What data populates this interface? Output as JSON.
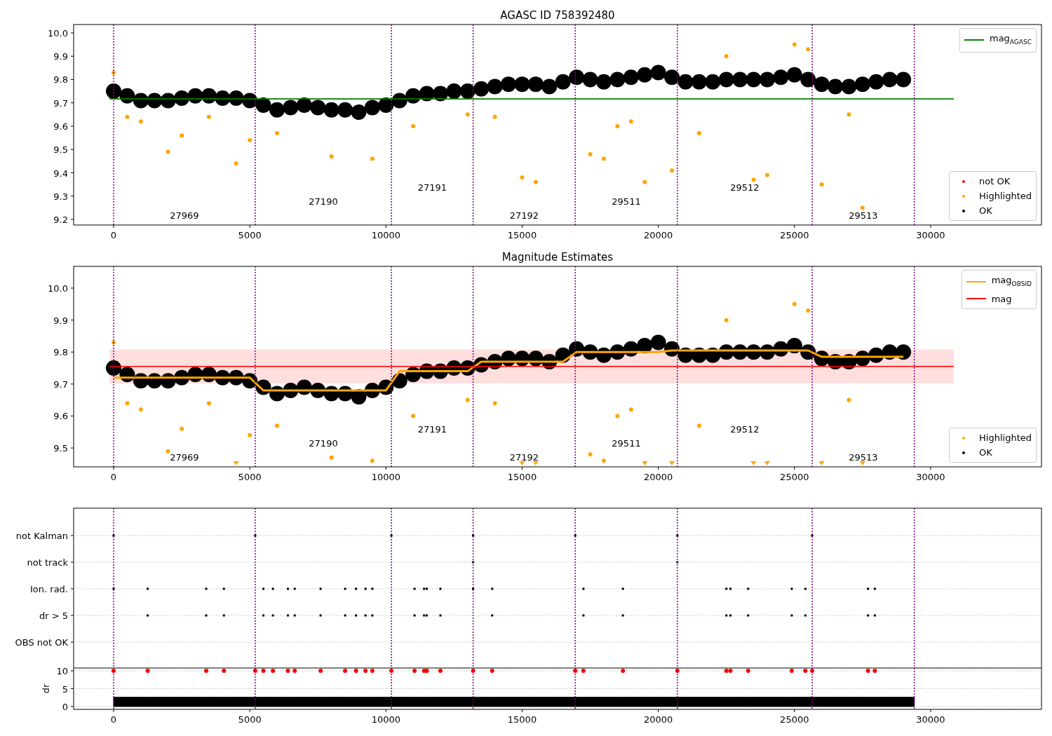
{
  "panels": [
    {
      "title": "AGASC ID 758392480",
      "chart_data": {
        "type": "scatter",
        "legend": "right",
        "xlim": [
          -1468,
          34070
        ],
        "ylim": [
          9.176,
          10.036
        ],
        "xticks": [
          0,
          5000,
          10000,
          15000,
          20000,
          25000,
          30000
        ],
        "yticks": [
          9.2,
          9.3,
          9.4,
          9.5,
          9.6,
          9.7,
          9.8,
          9.9,
          {
            "value": 10,
            "label": "10.0"
          }
        ],
        "x": [
          0,
          500,
          1000,
          1500,
          2000,
          2500,
          3000,
          3500,
          4000,
          4500,
          5000,
          5500,
          6000,
          6500,
          7000,
          7500,
          8000,
          8500,
          9000,
          9500,
          10000,
          10500,
          11000,
          11500,
          12000,
          12500,
          13000,
          13500,
          14000,
          14500,
          15000,
          15500,
          16000,
          16500,
          17000,
          17500,
          18000,
          18500,
          19000,
          19500,
          20000,
          20500,
          21000,
          21500,
          22000,
          22500,
          23000,
          23500,
          24000,
          24500,
          25000,
          25500,
          26000,
          26500,
          27000,
          27500,
          28000,
          28500,
          29000
        ],
        "series": [
          {
            "name": "not OK",
            "color": "#ff0000",
            "values": [
              null,
              null,
              null,
              null,
              null,
              null,
              null,
              null,
              null,
              null,
              null,
              null,
              null,
              null,
              null,
              null,
              null,
              null,
              null,
              null,
              null,
              null,
              null,
              null,
              null,
              null,
              null,
              null,
              null,
              null,
              null,
              null,
              null,
              null,
              null,
              null,
              null,
              null,
              null,
              null,
              null,
              null,
              null,
              null,
              null,
              null,
              null,
              null,
              null,
              null,
              null,
              null,
              null,
              null,
              null,
              null,
              null,
              null,
              null
            ]
          },
          {
            "name": "Highlighted",
            "color": "#ffa500",
            "values": [
              9.83,
              9.64,
              9.62,
              null,
              9.49,
              9.56,
              null,
              9.64,
              null,
              9.44,
              9.54,
              null,
              9.57,
              null,
              null,
              null,
              9.47,
              null,
              null,
              9.46,
              null,
              null,
              9.6,
              null,
              null,
              null,
              9.65,
              null,
              9.64,
              null,
              9.38,
              9.36,
              null,
              null,
              null,
              9.48,
              9.46,
              9.6,
              9.62,
              9.36,
              null,
              9.41,
              null,
              9.57,
              null,
              9.9,
              null,
              9.37,
              9.39,
              null,
              9.95,
              9.93,
              9.35,
              null,
              9.65,
              9.25,
              null,
              null,
              null
            ]
          },
          {
            "name": "OK",
            "color": "#000000",
            "values": [
              9.75,
              9.73,
              9.71,
              9.71,
              9.71,
              9.72,
              9.73,
              9.73,
              9.72,
              9.72,
              9.71,
              9.69,
              9.67,
              9.68,
              9.69,
              9.68,
              9.67,
              9.67,
              9.66,
              9.68,
              9.69,
              9.71,
              9.73,
              9.74,
              9.74,
              9.75,
              9.75,
              9.76,
              9.77,
              9.78,
              9.78,
              9.78,
              9.77,
              9.79,
              9.81,
              9.8,
              9.79,
              9.8,
              9.81,
              9.82,
              9.83,
              9.81,
              9.79,
              9.79,
              9.79,
              9.8,
              9.8,
              9.8,
              9.8,
              9.81,
              9.82,
              9.8,
              9.78,
              9.77,
              9.77,
              9.78,
              9.79,
              9.8,
              9.8
            ]
          }
        ],
        "ref_lines": [
          {
            "axis": "y",
            "label": "mag$_{AGASC}$",
            "value": 9.717,
            "color": "#008000"
          },
          {
            "axis": "x",
            "value": 0,
            "color": "#800080"
          },
          {
            "axis": "x",
            "value": 5200,
            "color": "#800080"
          },
          {
            "axis": "x",
            "value": 10200,
            "color": "#800080"
          },
          {
            "axis": "x",
            "value": 13200,
            "color": "#800080"
          },
          {
            "axis": "x",
            "value": 16950,
            "color": "#800080"
          },
          {
            "axis": "x",
            "value": 20700,
            "color": "#800080"
          },
          {
            "axis": "x",
            "value": 25650,
            "color": "#800080"
          },
          {
            "axis": "x",
            "value": 29400,
            "color": "#800080"
          }
        ],
        "annotations": [
          "27969",
          "27190",
          "27191",
          "27192",
          "29511",
          "29512",
          "29513"
        ]
      }
    },
    {
      "title": "Magnitude Estimates",
      "chart_data": {
        "type": "scatter",
        "legend": "right",
        "xlim": [
          -1468,
          34070
        ],
        "ylim": [
          9.441,
          10.068
        ],
        "xticks": [
          0,
          5000,
          10000,
          15000,
          20000,
          25000,
          30000
        ],
        "yticks": [
          9.5,
          9.6,
          9.7,
          9.8,
          9.9,
          {
            "value": 10,
            "label": "10.0"
          }
        ],
        "x": [
          0,
          500,
          1000,
          1500,
          2000,
          2500,
          3000,
          3500,
          4000,
          4500,
          5000,
          5500,
          6000,
          6500,
          7000,
          7500,
          8000,
          8500,
          9000,
          9500,
          10000,
          10500,
          11000,
          11500,
          12000,
          12500,
          13000,
          13500,
          14000,
          14500,
          15000,
          15500,
          16000,
          16500,
          17000,
          17500,
          18000,
          18500,
          19000,
          19500,
          20000,
          20500,
          21000,
          21500,
          22000,
          22500,
          23000,
          23500,
          24000,
          24500,
          25000,
          25500,
          26000,
          26500,
          27000,
          27500,
          28000,
          28500,
          29000
        ],
        "series": [
          {
            "name": "mag$_{OBSID}$",
            "color": "#ffa500",
            "type": "line",
            "values": [
              9.72,
              9.72,
              9.72,
              9.72,
              9.72,
              9.72,
              9.72,
              9.72,
              9.72,
              9.72,
              9.72,
              9.68,
              9.68,
              9.68,
              9.68,
              9.68,
              9.68,
              9.68,
              9.68,
              9.68,
              9.68,
              9.74,
              9.74,
              9.74,
              9.74,
              9.74,
              9.74,
              9.77,
              9.77,
              9.77,
              9.77,
              9.77,
              9.77,
              9.77,
              9.8,
              9.8,
              9.8,
              9.8,
              9.8,
              9.8,
              9.8,
              9.805,
              9.805,
              9.805,
              9.805,
              9.805,
              9.805,
              9.805,
              9.805,
              9.805,
              9.805,
              9.805,
              9.785,
              9.785,
              9.785,
              9.785,
              9.785,
              9.785,
              9.785
            ]
          },
          {
            "name": "Highlighted",
            "color": "#ffa500",
            "values": [
              9.83,
              9.64,
              9.62,
              null,
              9.49,
              9.56,
              null,
              9.64,
              null,
              9.452,
              9.54,
              null,
              9.57,
              null,
              null,
              null,
              9.47,
              null,
              null,
              9.46,
              null,
              null,
              9.6,
              null,
              null,
              null,
              9.65,
              null,
              9.64,
              null,
              9.452,
              9.452,
              null,
              null,
              null,
              9.48,
              9.46,
              9.6,
              9.62,
              9.452,
              null,
              9.452,
              null,
              9.57,
              null,
              9.9,
              null,
              9.452,
              9.452,
              null,
              9.95,
              9.93,
              9.452,
              null,
              9.65,
              9.452,
              null,
              null,
              null
            ]
          },
          {
            "name": "OK",
            "color": "#000000",
            "values": [
              9.75,
              9.73,
              9.71,
              9.71,
              9.71,
              9.72,
              9.73,
              9.73,
              9.72,
              9.72,
              9.71,
              9.69,
              9.67,
              9.68,
              9.69,
              9.68,
              9.67,
              9.67,
              9.66,
              9.68,
              9.69,
              9.71,
              9.73,
              9.74,
              9.74,
              9.75,
              9.75,
              9.76,
              9.77,
              9.78,
              9.78,
              9.78,
              9.77,
              9.79,
              9.81,
              9.8,
              9.79,
              9.8,
              9.81,
              9.82,
              9.83,
              9.81,
              9.79,
              9.79,
              9.79,
              9.8,
              9.8,
              9.8,
              9.8,
              9.81,
              9.82,
              9.8,
              9.78,
              9.77,
              9.77,
              9.78,
              9.79,
              9.8,
              9.8
            ]
          }
        ],
        "bands": [
          {
            "axis": "y",
            "from": 9.702,
            "to": 9.808,
            "color": "#ff0000"
          }
        ],
        "ref_lines": [
          {
            "axis": "y",
            "label": "mag",
            "value": 9.755,
            "color": "#ff0000"
          },
          {
            "axis": "x",
            "value": 0,
            "color": "#800080"
          },
          {
            "axis": "x",
            "value": 5200,
            "color": "#800080"
          },
          {
            "axis": "x",
            "value": 10200,
            "color": "#800080"
          },
          {
            "axis": "x",
            "value": 13200,
            "color": "#800080"
          },
          {
            "axis": "x",
            "value": 16950,
            "color": "#800080"
          },
          {
            "axis": "x",
            "value": 20700,
            "color": "#800080"
          },
          {
            "axis": "x",
            "value": 25650,
            "color": "#800080"
          },
          {
            "axis": "x",
            "value": 29400,
            "color": "#800080"
          }
        ],
        "annotations": [
          "27969",
          "27190",
          "27191",
          "27192",
          "29511",
          "29512",
          "29513"
        ]
      }
    }
  ],
  "flags": {
    "rows": [
      "not Kalman",
      "not track",
      "Ion. rad.",
      "dr > 5",
      "OBS not OK"
    ]
  },
  "dr": {
    "chart_data": {
      "type": "scatter",
      "grid": true,
      "ylabel": "dr",
      "xlim": [
        -1468,
        34070
      ],
      "ylim": [
        -0.8,
        10.8
      ],
      "xticks": [
        0,
        5000,
        10000,
        15000,
        20000,
        25000,
        30000
      ],
      "yticks": [
        0,
        5,
        10
      ],
      "x": [
        0,
        1250,
        3400,
        4050,
        5200,
        5500,
        5850,
        6400,
        6650,
        7600,
        8500,
        8900,
        9250,
        9500,
        10200,
        11050,
        11400,
        11500,
        12000,
        13200,
        13900,
        16950,
        17250,
        18700,
        20700,
        22500,
        22650,
        23300,
        24900,
        25400,
        25650,
        27700,
        27950,
        29400
      ],
      "series": [
        {
          "type": "area",
          "color": "#000000",
          "values": [
            2.6,
            2.6,
            2.6,
            2.6,
            2.6,
            2.6,
            2.6,
            2.6,
            2.6,
            2.6,
            2.6,
            2.6,
            2.6,
            2.6,
            2.6,
            2.6,
            2.6,
            2.6,
            2.6,
            2.6,
            2.6,
            2.6,
            2.6,
            2.6,
            2.6,
            2.6,
            2.6,
            2.6,
            2.6,
            2.6,
            2.6,
            2.6,
            2.6,
            2.6
          ]
        },
        {
          "color": "#ff0000",
          "values": [
            10,
            10,
            10,
            10,
            10,
            10,
            10,
            10,
            10,
            10,
            10,
            10,
            10,
            10,
            10,
            10,
            10,
            10,
            10,
            10,
            10,
            10,
            10,
            10,
            10,
            10,
            10,
            10,
            10,
            10,
            10,
            10,
            10,
            null
          ]
        }
      ],
      "ref_lines": [
        {
          "axis": "x",
          "value": 0,
          "color": "#800080"
        },
        {
          "axis": "x",
          "value": 5200,
          "color": "#800080"
        },
        {
          "axis": "x",
          "value": 10200,
          "color": "#800080"
        },
        {
          "axis": "x",
          "value": 13200,
          "color": "#800080"
        },
        {
          "axis": "x",
          "value": 16950,
          "color": "#800080"
        },
        {
          "axis": "x",
          "value": 20700,
          "color": "#800080"
        },
        {
          "axis": "x",
          "value": 25650,
          "color": "#800080"
        },
        {
          "axis": "x",
          "value": 29400,
          "color": "#800080"
        }
      ]
    }
  }
}
